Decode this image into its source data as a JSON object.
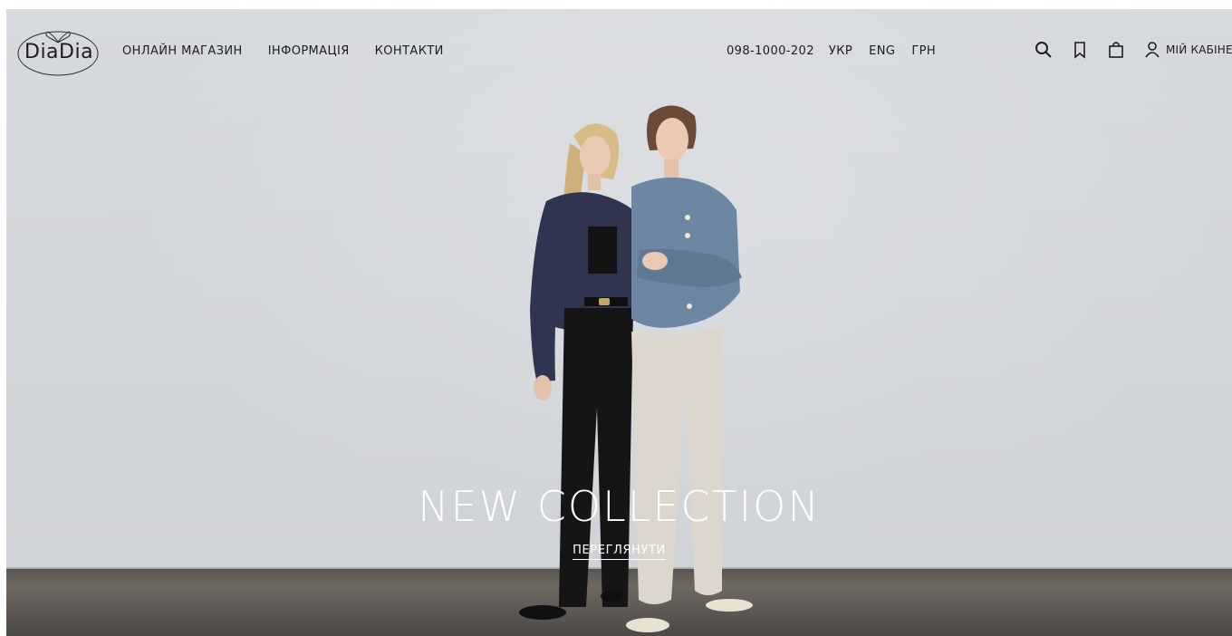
{
  "header": {
    "logo_text": "DiaDia",
    "nav": [
      {
        "label": "ОНЛАЙН МАГАЗИН"
      },
      {
        "label": "ІНФОРМАЦІЯ"
      },
      {
        "label": "КОНТАКТИ"
      }
    ],
    "phone": "098-1000-202",
    "languages": [
      "УКР",
      "ENG"
    ],
    "currency": "ГРН",
    "icons": [
      "search-icon",
      "bookmark-icon",
      "bag-icon",
      "user-icon"
    ],
    "cabinet_label": "МІЙ КАБІНЕТ"
  },
  "hero": {
    "title": "NEW COLLECTION",
    "cta_label": "ПЕРЕГЛЯНУТИ"
  },
  "colors": {
    "wall": "#d3d6da",
    "floor": "#5f5a55",
    "text_dark": "#1d1d1d",
    "text_light": "#ffffff"
  }
}
